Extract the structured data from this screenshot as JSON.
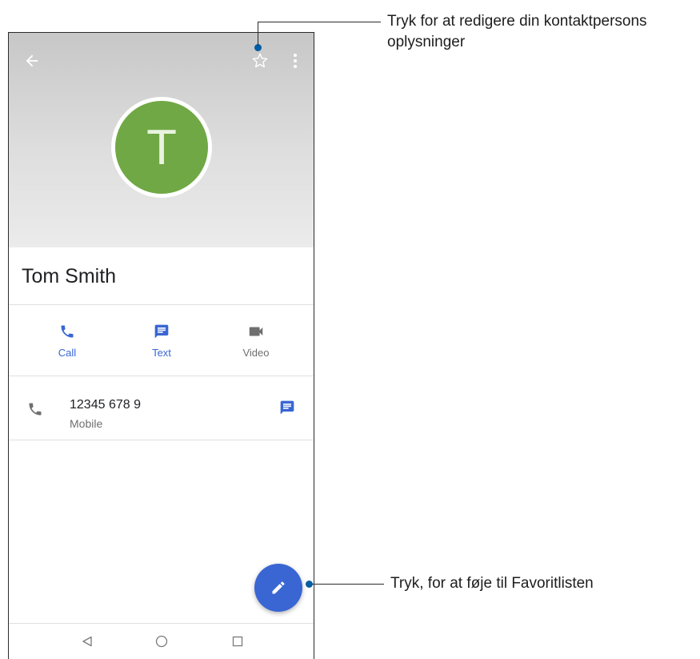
{
  "contact": {
    "initial": "T",
    "name": "Tom Smith",
    "avatar_color": "#70a846"
  },
  "header_icons": [
    "back-arrow-icon",
    "star-icon",
    "more-vert-icon"
  ],
  "actions": [
    {
      "label": "Call",
      "icon": "phone-icon",
      "color": "#3966d3"
    },
    {
      "label": "Text",
      "icon": "message-icon",
      "color": "#3966d3"
    },
    {
      "label": "Video",
      "icon": "videocam-icon",
      "color": "#6f6f6f"
    }
  ],
  "phone_entry": {
    "number": "12345 678 9",
    "type": "Mobile"
  },
  "fab_icon": "edit-pencil-icon",
  "nav_icons": [
    "back-triangle-icon",
    "home-circle-icon",
    "recents-square-icon"
  ],
  "callouts": {
    "top_text_line1": "Tryk for at redigere din kontaktpersons",
    "top_text_line2": "oplysninger",
    "bottom_text": "Tryk, for at føje til Favoritlisten"
  },
  "colors": {
    "accent": "#3966d3",
    "callout_dot": "#005ea5"
  }
}
